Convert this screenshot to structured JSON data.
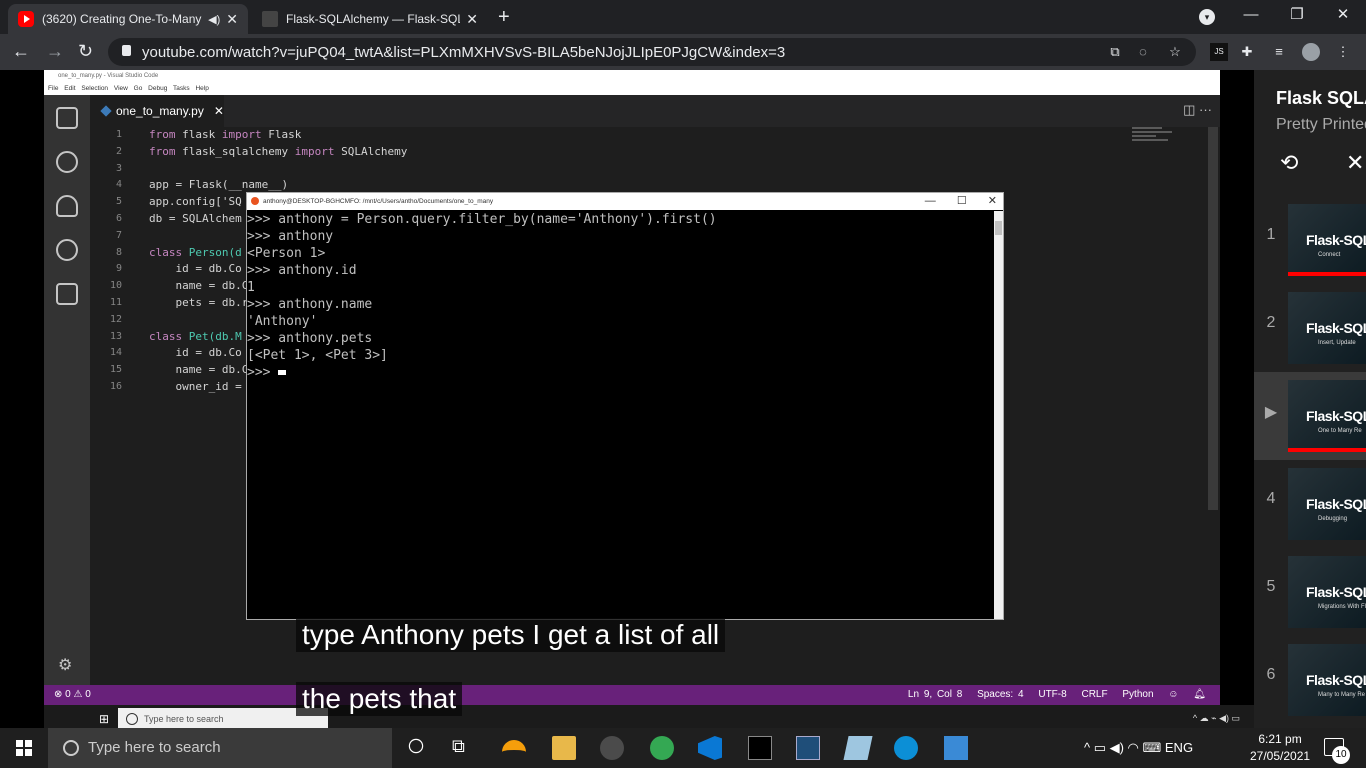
{
  "browser": {
    "tabs": [
      {
        "title": "(3620) Creating One-To-Many",
        "close": "✕",
        "sound": "◀)"
      },
      {
        "title": "Flask-SQLAlchemy — Flask-SQLA",
        "close": "✕"
      }
    ],
    "new_tab": "+",
    "window_controls": {
      "minimize": "—",
      "restore": "❐",
      "close": "✕"
    },
    "address": {
      "host": "youtube.com",
      "path": "/watch?v=juPQ04_twtA&list=PLXmMXHVSvS-BILA5beNJojJLIpE0PJgCW&index=3"
    },
    "nav": {
      "back": "←",
      "forward": "→",
      "reload": "↻"
    }
  },
  "vscode": {
    "window_title": "one_to_many.py - Visual Studio Code",
    "menu": [
      "File",
      "Edit",
      "Selection",
      "View",
      "Go",
      "Debug",
      "Tasks",
      "Help"
    ],
    "tab": {
      "label": "one_to_many.py",
      "close": "✕"
    },
    "line_numbers": [
      "1",
      "2",
      "3",
      "4",
      "5",
      "6",
      "7",
      "8",
      "9",
      "10",
      "11",
      "12",
      "13",
      "14",
      "15",
      "16"
    ],
    "status_left": "⊗ 0 ⚠ 0",
    "status_right": {
      "position": "Ln 9, Col 8",
      "spaces": "Spaces: 4",
      "encoding": "UTF-8",
      "eol": "CRLF",
      "language": "Python"
    },
    "code_lines": [
      {
        "kw": "from",
        "a": " flask ",
        "kw2": "import",
        "b": " Flask"
      },
      {
        "kw": "from",
        "a": " flask_sqlalchemy ",
        "kw2": "import",
        "b": " SQLAlchemy"
      },
      {
        "kw": "",
        "a": "",
        "kw2": "",
        "b": ""
      },
      {
        "kw": "",
        "a": "app = Flask(__name__)",
        "kw2": "",
        "b": ""
      },
      {
        "kw": "",
        "a": "app.config['SQ",
        "kw2": "",
        "b": ""
      },
      {
        "kw": "",
        "a": "db = SQLAlchem",
        "kw2": "",
        "b": ""
      },
      {
        "kw": "",
        "a": "",
        "kw2": "",
        "b": ""
      },
      {
        "kw": "class",
        "a": " ",
        "kw2": "",
        "b": "Person(d"
      },
      {
        "kw": "",
        "a": "    id = db.Co",
        "kw2": "",
        "b": ""
      },
      {
        "kw": "",
        "a": "    name = db.C",
        "kw2": "",
        "b": ""
      },
      {
        "kw": "",
        "a": "    pets = db.r",
        "kw2": "",
        "b": ""
      },
      {
        "kw": "",
        "a": "",
        "kw2": "",
        "b": ""
      },
      {
        "kw": "class",
        "a": " ",
        "kw2": "",
        "b": "Pet(db.M"
      },
      {
        "kw": "",
        "a": "    id = db.Co",
        "kw2": "",
        "b": ""
      },
      {
        "kw": "",
        "a": "    name = db.C",
        "kw2": "",
        "b": ""
      },
      {
        "kw": "",
        "a": "    owner_id =",
        "kw2": "",
        "b": ""
      }
    ],
    "inner_search_placeholder": "Type here to search"
  },
  "terminal": {
    "title": "anthony@DESKTOP-BGHCMFO: /mnt/c/Users/antho/Documents/one_to_many",
    "controls": "— ☐ ✕",
    "lines": [
      ">>> anthony = Person.query.filter_by(name='Anthony').first()",
      ">>> anthony",
      "<Person 1>",
      ">>> anthony.id",
      "1",
      ">>> anthony.name",
      "'Anthony'",
      ">>> anthony.pets",
      "[<Pet 1>, <Pet 3>]"
    ],
    "prompt": ">>> "
  },
  "captions": [
    "type Anthony pets I get a list of all",
    "the pets that"
  ],
  "playlist": {
    "title": "Flask SQLAlchemy",
    "subtitle": "Pretty Printed",
    "loop_icon": "⟲",
    "shuffle_icon": "✕",
    "items": [
      {
        "index": "1",
        "thumb_title": "Flask-SQLA",
        "thumb_sub": "Connect",
        "progress": 1.0,
        "active": false
      },
      {
        "index": "2",
        "thumb_title": "Flask-SQLA",
        "thumb_sub": "Insert, Update",
        "progress": 0.0,
        "active": false
      },
      {
        "index": "▶",
        "thumb_title": "Flask-SQLA",
        "thumb_sub": "One to Many Re",
        "progress": 1.0,
        "active": true
      },
      {
        "index": "4",
        "thumb_title": "Flask-SQLA",
        "thumb_sub": "Debugging",
        "progress": 0.0,
        "active": false
      },
      {
        "index": "5",
        "thumb_title": "Flask-SQLA",
        "thumb_sub": "Migrations With Fl",
        "progress": 0.0,
        "active": false
      },
      {
        "index": "6",
        "thumb_title": "Flask-SQLA",
        "thumb_sub": "Many to Many Re",
        "progress": 0.0,
        "active": false
      }
    ]
  },
  "taskbar": {
    "search_placeholder": "Type here to search",
    "language": "ENG",
    "time": "6:21 pm",
    "date": "27/05/2021",
    "notification_count": "10"
  }
}
